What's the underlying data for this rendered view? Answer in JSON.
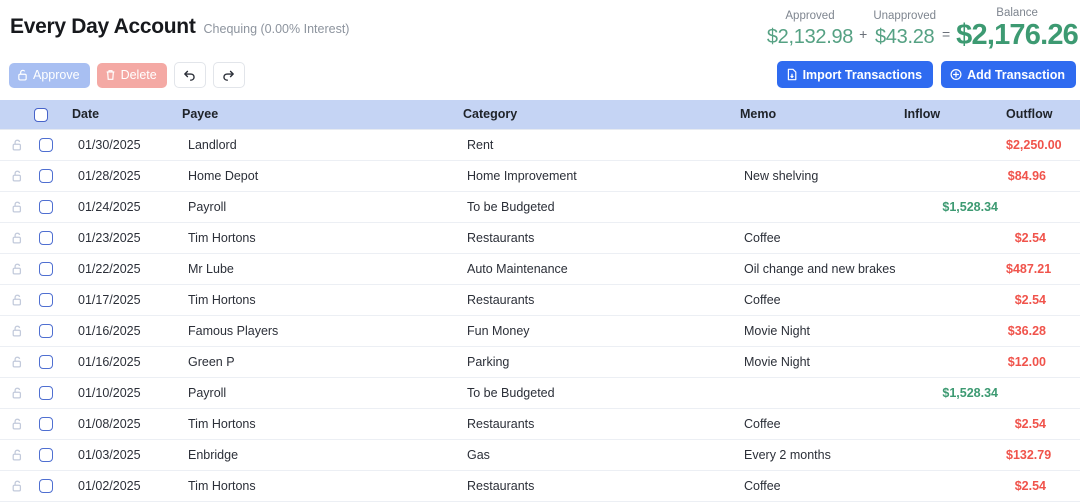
{
  "header": {
    "account_title": "Every Day Account",
    "account_subtitle": "Chequing (0.00% Interest)"
  },
  "balance": {
    "approved_label": "Approved",
    "approved_value": "$2,132.98",
    "plus_sign": "+",
    "unapproved_label": "Unapproved",
    "unapproved_value": "$43.28",
    "equals_sign": "=",
    "balance_label": "Balance",
    "balance_value": "$2,176.26",
    "green": "#55a183",
    "green_bold": "#3d9a72"
  },
  "toolbar": {
    "approve_label": "Approve",
    "delete_label": "Delete",
    "undo_icon": "undo-arrow-icon",
    "redo_icon": "redo-arrow-icon",
    "import_label": "Import Transactions",
    "add_label": "Add Transaction",
    "primary_color": "#2f6bf0",
    "approve_color": "#a8bff2",
    "delete_color": "#f4a9a4"
  },
  "table": {
    "header_bg": "#c5d4f4",
    "columns": [
      "",
      "",
      "Date",
      "Payee",
      "Category",
      "Memo",
      "Inflow",
      "Outflow"
    ],
    "outflow_color": "#f0534b",
    "inflow_color": "#3d9a72",
    "rows": [
      {
        "date": "01/30/2025",
        "payee": "Landlord",
        "category": "Rent",
        "memo": "",
        "inflow": "",
        "outflow": "$2,250.00"
      },
      {
        "date": "01/28/2025",
        "payee": "Home Depot",
        "category": "Home Improvement",
        "memo": "New shelving",
        "inflow": "",
        "outflow": "$84.96"
      },
      {
        "date": "01/24/2025",
        "payee": "Payroll",
        "category": "To be Budgeted",
        "memo": "",
        "inflow": "$1,528.34",
        "outflow": ""
      },
      {
        "date": "01/23/2025",
        "payee": "Tim Hortons",
        "category": "Restaurants",
        "memo": "Coffee",
        "inflow": "",
        "outflow": "$2.54"
      },
      {
        "date": "01/22/2025",
        "payee": "Mr Lube",
        "category": "Auto Maintenance",
        "memo": "Oil change and new brakes",
        "inflow": "",
        "outflow": "$487.21"
      },
      {
        "date": "01/17/2025",
        "payee": "Tim Hortons",
        "category": "Restaurants",
        "memo": "Coffee",
        "inflow": "",
        "outflow": "$2.54"
      },
      {
        "date": "01/16/2025",
        "payee": "Famous Players",
        "category": "Fun Money",
        "memo": "Movie Night",
        "inflow": "",
        "outflow": "$36.28"
      },
      {
        "date": "01/16/2025",
        "payee": "Green P",
        "category": "Parking",
        "memo": "Movie Night",
        "inflow": "",
        "outflow": "$12.00"
      },
      {
        "date": "01/10/2025",
        "payee": "Payroll",
        "category": "To be Budgeted",
        "memo": "",
        "inflow": "$1,528.34",
        "outflow": ""
      },
      {
        "date": "01/08/2025",
        "payee": "Tim Hortons",
        "category": "Restaurants",
        "memo": "Coffee",
        "inflow": "",
        "outflow": "$2.54"
      },
      {
        "date": "01/03/2025",
        "payee": "Enbridge",
        "category": "Gas",
        "memo": "Every 2 months",
        "inflow": "",
        "outflow": "$132.79"
      },
      {
        "date": "01/02/2025",
        "payee": "Tim Hortons",
        "category": "Restaurants",
        "memo": "Coffee",
        "inflow": "",
        "outflow": "$2.54"
      }
    ]
  }
}
